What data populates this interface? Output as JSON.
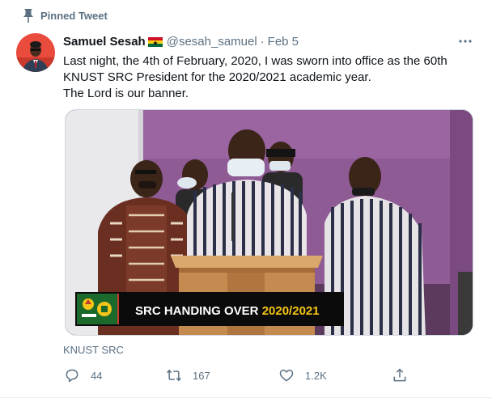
{
  "pinned_label": "Pinned Tweet",
  "author": {
    "name": "Samuel Sesah",
    "handle": "@sesah_samuel",
    "date": "Feb 5",
    "separator": "·"
  },
  "tweet_lines": [
    "Last night, the 4th of February, 2020, I was sworn into office as the 60th",
    "KNUST SRC President for the 2020/2021 academic year.",
    "The Lord is our banner."
  ],
  "media": {
    "banner_text_white": "SRC HANDING OVER ",
    "banner_text_yellow": "2020/2021"
  },
  "source": "KNUST SRC",
  "actions": {
    "reply_count": "44",
    "retweet_count": "167",
    "like_count": "1.2K"
  },
  "icons": {
    "pin": "pin-icon",
    "more": "more-icon",
    "reply": "reply-icon",
    "retweet": "retweet-icon",
    "like": "like-icon",
    "share": "share-icon"
  },
  "colors": {
    "secondary_text": "#5b7083",
    "primary_text": "#0f1419",
    "banner_yellow": "#f5c518"
  }
}
